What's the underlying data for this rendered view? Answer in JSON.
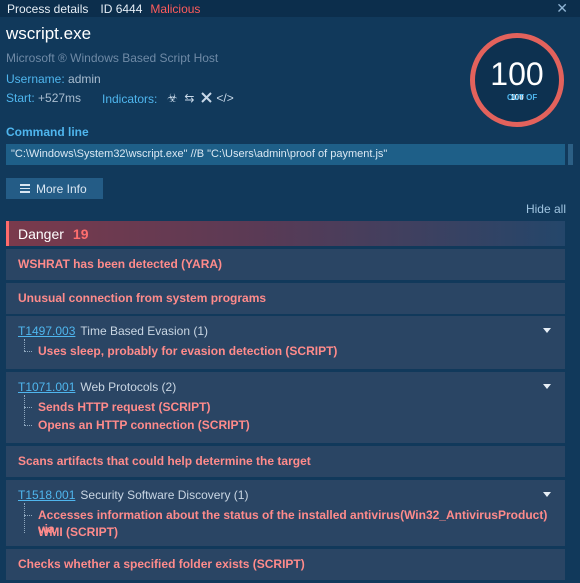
{
  "titlebar": {
    "title": "Process details",
    "id": "ID 6444",
    "status": "Malicious",
    "close": "✕"
  },
  "process": {
    "name": "wscript.exe",
    "description": "Microsoft ® Windows Based Script Host",
    "username_label": "Username:",
    "username": "admin",
    "start_label": "Start:",
    "start": "+527ms",
    "indicators_label": "Indicators:",
    "indicator_icons": [
      "biohazard-icon",
      "connection-arrows-icon",
      "tools-icon",
      "code-icon"
    ]
  },
  "score": {
    "value": "100",
    "out_of_label": "OUT OF",
    "max": "100",
    "ring_color": "#e3625c"
  },
  "command": {
    "label": "Command line",
    "value": "\"C:\\Windows\\System32\\wscript.exe\" //B \"C:\\Users\\admin\\proof of payment.js\""
  },
  "buttons": {
    "more_info": "More Info",
    "hide_all": "Hide all"
  },
  "danger": {
    "label": "Danger",
    "count": "19",
    "items": [
      {
        "text": "WSHRAT has been detected (YARA)"
      },
      {
        "text": "Unusual connection from system programs"
      },
      {
        "tid": "T1497.003",
        "tname": "Time Based Evasion (1)",
        "subs": [
          "Uses sleep, probably for evasion detection (SCRIPT)"
        ]
      },
      {
        "tid": "T1071.001",
        "tname": "Web Protocols (2)",
        "subs": [
          "Sends HTTP request (SCRIPT)",
          "Opens an HTTP connection (SCRIPT)"
        ]
      },
      {
        "text": "Scans artifacts that could help determine the target"
      },
      {
        "tid": "T1518.001",
        "tname": "Security Software Discovery (1)",
        "subs": [
          "Accesses information about the status of the installed antivirus(Win32_AntivirusProduct) via",
          "WMI (SCRIPT)"
        ]
      },
      {
        "text": "Checks whether a specified folder exists (SCRIPT)"
      }
    ]
  },
  "colors": {
    "background": "#11395b",
    "accent": "#4fb6ee",
    "danger": "#ff8b8b",
    "malicious": "#ff5c5c"
  }
}
